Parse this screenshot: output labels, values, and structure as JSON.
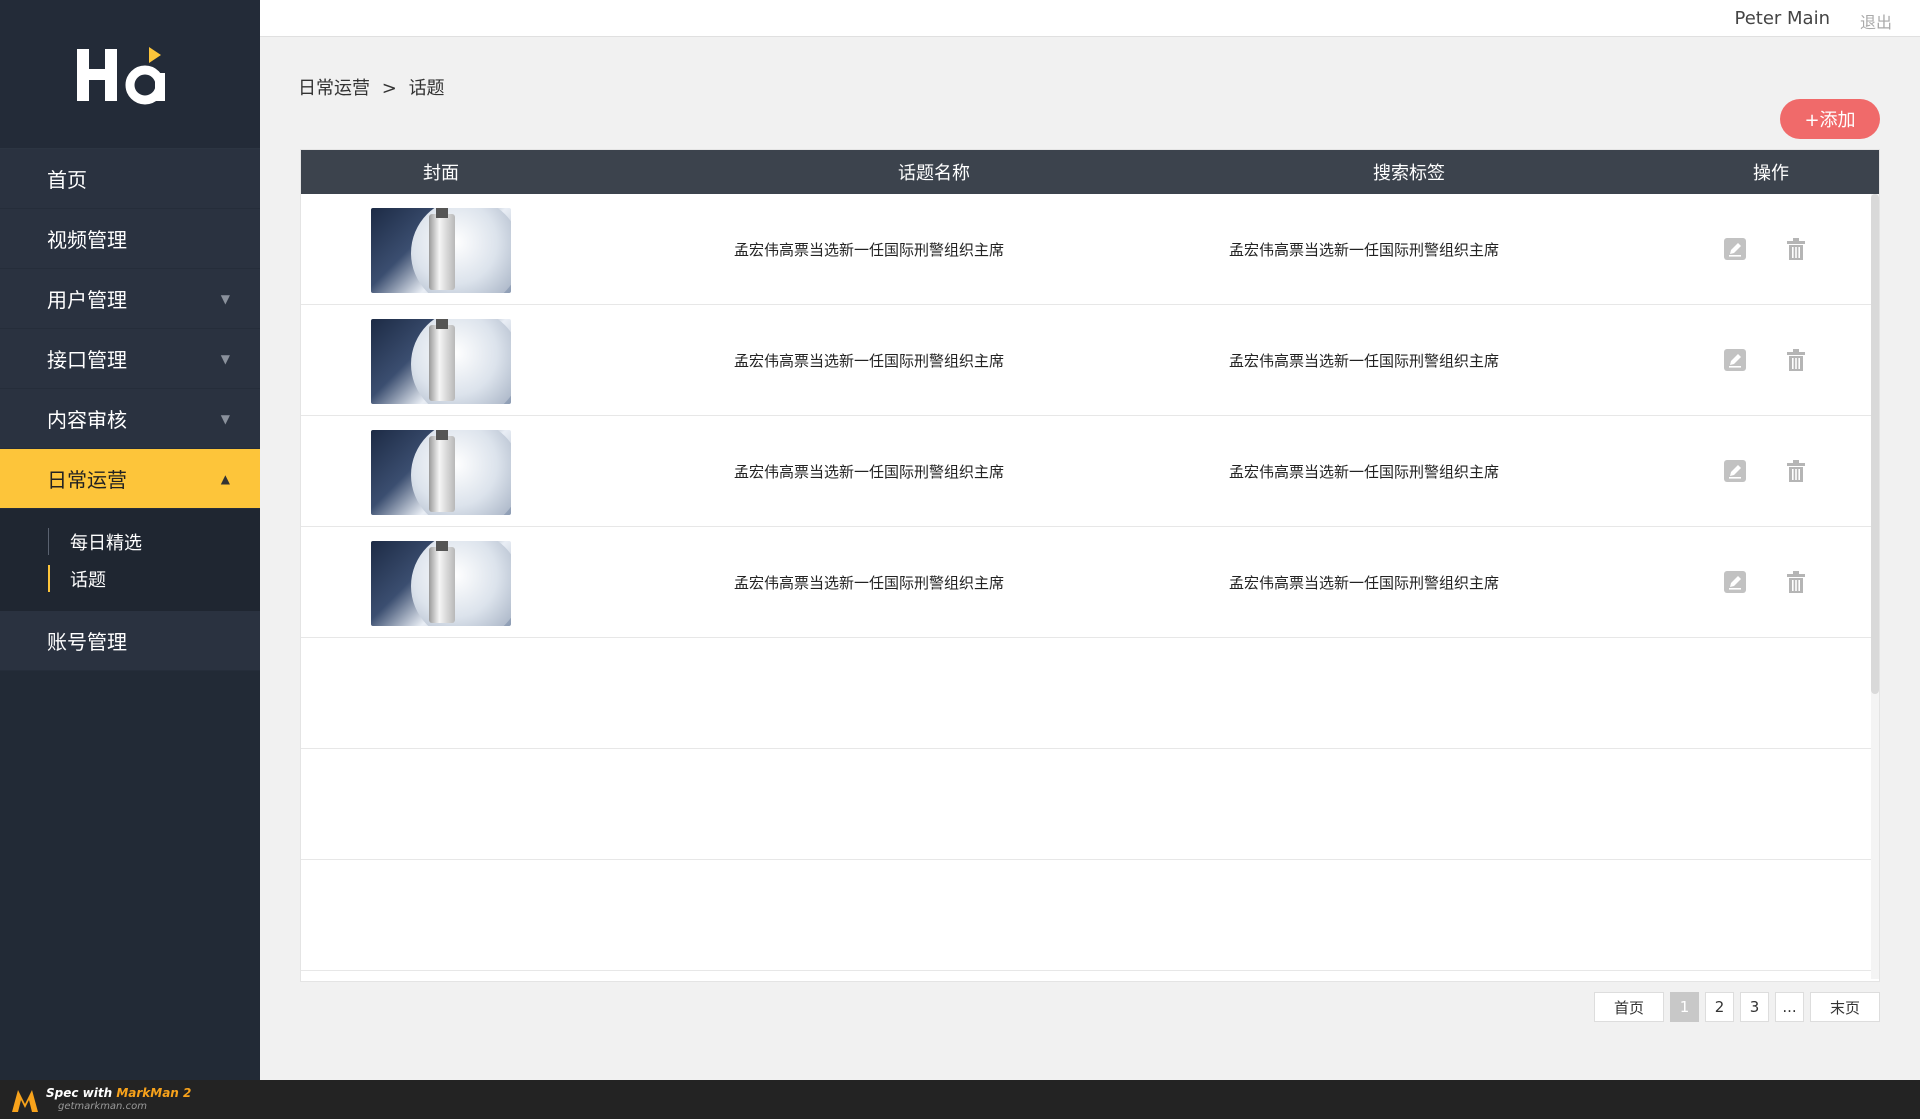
{
  "sidebar": {
    "logo_text": "Ha",
    "items": [
      {
        "label": "首页",
        "has_arrow": false
      },
      {
        "label": "视频管理",
        "has_arrow": false
      },
      {
        "label": "用户管理",
        "has_arrow": true
      },
      {
        "label": "接口管理",
        "has_arrow": true
      },
      {
        "label": "内容审核",
        "has_arrow": true
      },
      {
        "label": "日常运营",
        "has_arrow": true,
        "active": true
      }
    ],
    "submenu": [
      {
        "label": "每日精选"
      },
      {
        "label": "话题",
        "active": true
      }
    ],
    "bottom_item": {
      "label": "账号管理"
    },
    "arrow_down": "▼",
    "arrow_up": "▲"
  },
  "topbar": {
    "username": "Peter Main",
    "logout": "退出"
  },
  "breadcrumb": {
    "parent": "日常运营",
    "separator": ">",
    "current": "话题"
  },
  "add_button": "+添加",
  "table": {
    "headers": [
      "封面",
      "话题名称",
      "搜索标签",
      "操作"
    ],
    "rows": [
      {
        "name": "孟宏伟高票当选新一任国际刑警组织主席",
        "tag": "孟宏伟高票当选新一任国际刑警组织主席"
      },
      {
        "name": "孟宏伟高票当选新一任国际刑警组织主席",
        "tag": "孟宏伟高票当选新一任国际刑警组织主席"
      },
      {
        "name": "孟宏伟高票当选新一任国际刑警组织主席",
        "tag": "孟宏伟高票当选新一任国际刑警组织主席"
      },
      {
        "name": "孟宏伟高票当选新一任国际刑警组织主席",
        "tag": "孟宏伟高票当选新一任国际刑警组织主席"
      }
    ]
  },
  "pagination": {
    "first": "首页",
    "pages": [
      "1",
      "2",
      "3"
    ],
    "ellipsis": "...",
    "last": "末页",
    "current_page": "1"
  },
  "footer": {
    "spec_text": "Spec with",
    "brand": "MarkMan 2",
    "url": "getmarkman.com"
  },
  "colors": {
    "sidebar_bg": "#222a36",
    "active_accent": "#fdc53a",
    "add_button": "#f06a6a",
    "table_header": "#3c434d"
  }
}
